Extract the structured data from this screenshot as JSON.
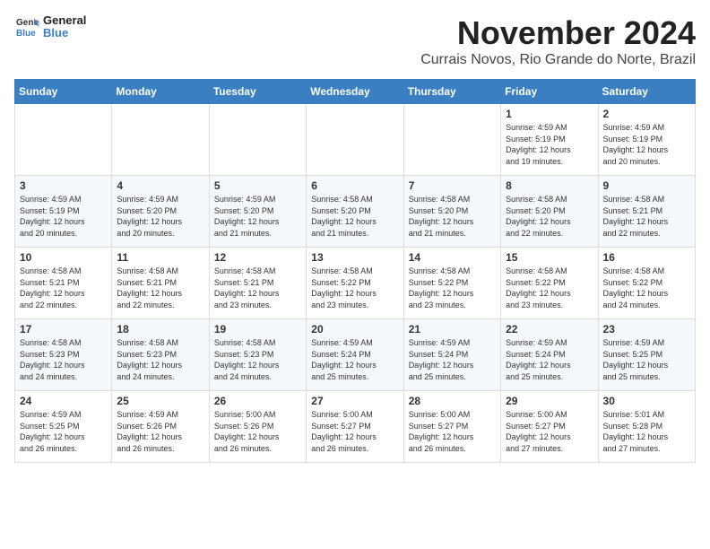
{
  "logo": {
    "line1": "General",
    "line2": "Blue"
  },
  "title": "November 2024",
  "subtitle": "Currais Novos, Rio Grande do Norte, Brazil",
  "days_of_week": [
    "Sunday",
    "Monday",
    "Tuesday",
    "Wednesday",
    "Thursday",
    "Friday",
    "Saturday"
  ],
  "weeks": [
    [
      {
        "day": "",
        "info": ""
      },
      {
        "day": "",
        "info": ""
      },
      {
        "day": "",
        "info": ""
      },
      {
        "day": "",
        "info": ""
      },
      {
        "day": "",
        "info": ""
      },
      {
        "day": "1",
        "info": "Sunrise: 4:59 AM\nSunset: 5:19 PM\nDaylight: 12 hours\nand 19 minutes."
      },
      {
        "day": "2",
        "info": "Sunrise: 4:59 AM\nSunset: 5:19 PM\nDaylight: 12 hours\nand 20 minutes."
      }
    ],
    [
      {
        "day": "3",
        "info": "Sunrise: 4:59 AM\nSunset: 5:19 PM\nDaylight: 12 hours\nand 20 minutes."
      },
      {
        "day": "4",
        "info": "Sunrise: 4:59 AM\nSunset: 5:20 PM\nDaylight: 12 hours\nand 20 minutes."
      },
      {
        "day": "5",
        "info": "Sunrise: 4:59 AM\nSunset: 5:20 PM\nDaylight: 12 hours\nand 21 minutes."
      },
      {
        "day": "6",
        "info": "Sunrise: 4:58 AM\nSunset: 5:20 PM\nDaylight: 12 hours\nand 21 minutes."
      },
      {
        "day": "7",
        "info": "Sunrise: 4:58 AM\nSunset: 5:20 PM\nDaylight: 12 hours\nand 21 minutes."
      },
      {
        "day": "8",
        "info": "Sunrise: 4:58 AM\nSunset: 5:20 PM\nDaylight: 12 hours\nand 22 minutes."
      },
      {
        "day": "9",
        "info": "Sunrise: 4:58 AM\nSunset: 5:21 PM\nDaylight: 12 hours\nand 22 minutes."
      }
    ],
    [
      {
        "day": "10",
        "info": "Sunrise: 4:58 AM\nSunset: 5:21 PM\nDaylight: 12 hours\nand 22 minutes."
      },
      {
        "day": "11",
        "info": "Sunrise: 4:58 AM\nSunset: 5:21 PM\nDaylight: 12 hours\nand 22 minutes."
      },
      {
        "day": "12",
        "info": "Sunrise: 4:58 AM\nSunset: 5:21 PM\nDaylight: 12 hours\nand 23 minutes."
      },
      {
        "day": "13",
        "info": "Sunrise: 4:58 AM\nSunset: 5:22 PM\nDaylight: 12 hours\nand 23 minutes."
      },
      {
        "day": "14",
        "info": "Sunrise: 4:58 AM\nSunset: 5:22 PM\nDaylight: 12 hours\nand 23 minutes."
      },
      {
        "day": "15",
        "info": "Sunrise: 4:58 AM\nSunset: 5:22 PM\nDaylight: 12 hours\nand 23 minutes."
      },
      {
        "day": "16",
        "info": "Sunrise: 4:58 AM\nSunset: 5:22 PM\nDaylight: 12 hours\nand 24 minutes."
      }
    ],
    [
      {
        "day": "17",
        "info": "Sunrise: 4:58 AM\nSunset: 5:23 PM\nDaylight: 12 hours\nand 24 minutes."
      },
      {
        "day": "18",
        "info": "Sunrise: 4:58 AM\nSunset: 5:23 PM\nDaylight: 12 hours\nand 24 minutes."
      },
      {
        "day": "19",
        "info": "Sunrise: 4:58 AM\nSunset: 5:23 PM\nDaylight: 12 hours\nand 24 minutes."
      },
      {
        "day": "20",
        "info": "Sunrise: 4:59 AM\nSunset: 5:24 PM\nDaylight: 12 hours\nand 25 minutes."
      },
      {
        "day": "21",
        "info": "Sunrise: 4:59 AM\nSunset: 5:24 PM\nDaylight: 12 hours\nand 25 minutes."
      },
      {
        "day": "22",
        "info": "Sunrise: 4:59 AM\nSunset: 5:24 PM\nDaylight: 12 hours\nand 25 minutes."
      },
      {
        "day": "23",
        "info": "Sunrise: 4:59 AM\nSunset: 5:25 PM\nDaylight: 12 hours\nand 25 minutes."
      }
    ],
    [
      {
        "day": "24",
        "info": "Sunrise: 4:59 AM\nSunset: 5:25 PM\nDaylight: 12 hours\nand 26 minutes."
      },
      {
        "day": "25",
        "info": "Sunrise: 4:59 AM\nSunset: 5:26 PM\nDaylight: 12 hours\nand 26 minutes."
      },
      {
        "day": "26",
        "info": "Sunrise: 5:00 AM\nSunset: 5:26 PM\nDaylight: 12 hours\nand 26 minutes."
      },
      {
        "day": "27",
        "info": "Sunrise: 5:00 AM\nSunset: 5:27 PM\nDaylight: 12 hours\nand 26 minutes."
      },
      {
        "day": "28",
        "info": "Sunrise: 5:00 AM\nSunset: 5:27 PM\nDaylight: 12 hours\nand 26 minutes."
      },
      {
        "day": "29",
        "info": "Sunrise: 5:00 AM\nSunset: 5:27 PM\nDaylight: 12 hours\nand 27 minutes."
      },
      {
        "day": "30",
        "info": "Sunrise: 5:01 AM\nSunset: 5:28 PM\nDaylight: 12 hours\nand 27 minutes."
      }
    ]
  ]
}
